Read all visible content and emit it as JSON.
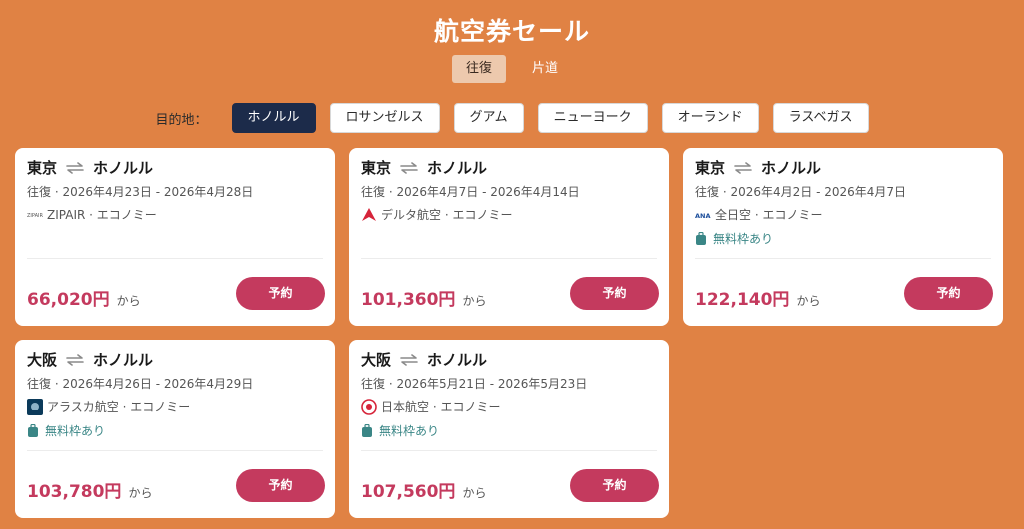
{
  "page_title": "航空券セール",
  "trip_type": {
    "options": [
      "往復",
      "片道"
    ],
    "selected": "往復"
  },
  "destination": {
    "label": "目的地：",
    "options": [
      "ホノルル",
      "ロサンゼルス",
      "グアム",
      "ニューヨーク",
      "オーランド",
      "ラスベガス"
    ],
    "selected": "ホノルル"
  },
  "cards": [
    {
      "origin": "東京",
      "destination": "ホノルル",
      "dates": "往復 · 2026年4月23日 - 2026年4月28日",
      "airline": "ZIPAIR · エコノミー",
      "airline_icon": "zipair-logo-icon",
      "baggage": "",
      "price": "66,020円",
      "price_suffix": "から",
      "book_label": "予約"
    },
    {
      "origin": "東京",
      "destination": "ホノルル",
      "dates": "往復 · 2026年4月7日 - 2026年4月14日",
      "airline": "デルタ航空 · エコノミー",
      "airline_icon": "delta-logo-icon",
      "baggage": "",
      "price": "101,360円",
      "price_suffix": "から",
      "book_label": "予約"
    },
    {
      "origin": "東京",
      "destination": "ホノルル",
      "dates": "往復 · 2026年4月2日 - 2026年4月7日",
      "airline": "全日空 · エコノミー",
      "airline_icon": "ana-logo-icon",
      "baggage": "無料枠あり",
      "price": "122,140円",
      "price_suffix": "から",
      "book_label": "予約"
    },
    {
      "origin": "大阪",
      "destination": "ホノルル",
      "dates": "往復 · 2026年4月26日 - 2026年4月29日",
      "airline": "アラスカ航空 · エコノミー",
      "airline_icon": "alaska-logo-icon",
      "baggage": "無料枠あり",
      "price": "103,780円",
      "price_suffix": "から",
      "book_label": "予約"
    },
    {
      "origin": "大阪",
      "destination": "ホノルル",
      "dates": "往復 · 2026年5月21日 - 2026年5月23日",
      "airline": "日本航空 · エコノミー",
      "airline_icon": "jal-logo-icon",
      "baggage": "無料枠あり",
      "price": "107,560円",
      "price_suffix": "から",
      "book_label": "予約"
    }
  ],
  "colors": {
    "background": "#e08244",
    "price": "#c43a5e",
    "book_button": "#c43a5e",
    "selected_destination": "#1c2b4a",
    "baggage": "#3a8686"
  }
}
